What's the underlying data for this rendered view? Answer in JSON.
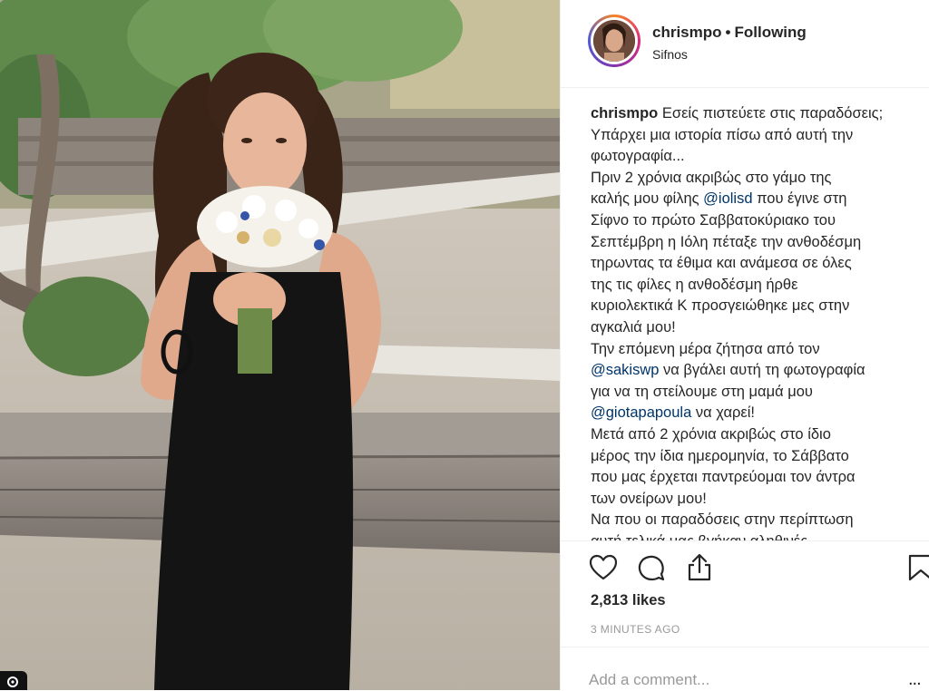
{
  "post": {
    "username": "chrismpo",
    "separator": "•",
    "follow_status": "Following",
    "location": "Sifnos",
    "caption": {
      "username": "chrismpo",
      "l1": "Εσείς πιστεύετε στις παραδόσεις;",
      "l2": "Υπάρχει μια ιστορία πίσω από αυτή την",
      "l3": "φωτογραφία...",
      "l4": "Πριν 2 χρόνια ακριβώς στο γάμο της",
      "l5a": "καλής μου φίλης ",
      "mention1": "@iolisd",
      "l5b": " που έγινε στη",
      "l6": "Σίφνο το πρώτο Σαββατοκύριακο του",
      "l7": "Σεπτέμβρη η Ιόλη πέταξε την ανθοδέσμη",
      "l8": "τηρωντας τα έθιμα και ανάμεσα σε όλες",
      "l9": "της τις φίλες η ανθοδέσμη ήρθε",
      "l10": "κυριολεκτικά Κ προσγειώθηκε μες στην",
      "l11": "αγκαλιά μου!",
      "l12": "Την επόμενη μέρα ζήτησα από τον",
      "mention2": "@sakiswp",
      "l13b": " να βγάλει αυτή τη φωτογραφία",
      "l14": "για να τη στείλουμε στη μαμά μου",
      "mention3": "@giotapapoula",
      "l15b": " να χαρεί!",
      "l16": "Μετά από 2 χρόνια ακριβώς στο ίδιο",
      "l17": "μέρος την ίδια ημερομηνία, το Σάββατο",
      "l18": "που μας έρχεται παντρεύομαι τον άντρα",
      "l19": "των ονείρων μου!",
      "l20": "Να που οι παραδόσεις στην περίπτωση",
      "l21": "αυτή τελικά μας βγήκαν αληθινές..."
    },
    "likes": "2,813 likes",
    "time_ago": "3 MINUTES AGO",
    "comment_placeholder": "Add a comment...",
    "more_label": "..."
  },
  "icons": {
    "like": "heart-icon",
    "comment": "speech-bubble-icon",
    "share": "share-icon",
    "save": "bookmark-icon",
    "corner": "instagram-badge-icon"
  },
  "colors": {
    "text": "#262626",
    "secondary": "#999999",
    "mention": "#003569",
    "border": "#efefef"
  }
}
